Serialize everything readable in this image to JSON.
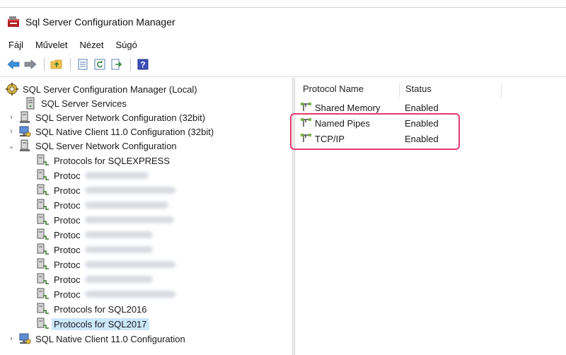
{
  "window": {
    "title": "Sql Server Configuration Manager"
  },
  "menu": [
    "Fájl",
    "Művelet",
    "Nézet",
    "Súgó"
  ],
  "toolbar": {
    "buttons": [
      "back-arrow-icon",
      "forward-arrow-icon",
      "up-folder-icon",
      "properties-icon",
      "refresh-icon",
      "export-icon",
      "help-icon"
    ],
    "help_glyph": "?"
  },
  "tree": {
    "root": "SQL Server Configuration Manager (Local)",
    "services": "SQL Server Services",
    "network32": "SQL Server Network Configuration (32bit)",
    "native32": "SQL Native Client 11.0 Configuration (32bit)",
    "network": "SQL Server Network Configuration",
    "protocols": [
      "Protocols for SQLEXPRESS",
      "Protoc",
      "Protoc",
      "Protoc",
      "Protoc",
      "Protoc",
      "Protoc",
      "Protoc",
      "Protoc",
      "Protoc",
      "Protocols for SQL2016"
    ],
    "selected": "Protocols for SQL2017",
    "native": "SQL Native Client 11.0 Configuration"
  },
  "list": {
    "columns": [
      "Protocol Name",
      "Status"
    ],
    "rows": [
      {
        "name": "Shared Memory",
        "status": "Enabled"
      },
      {
        "name": "Named Pipes",
        "status": "Enabled"
      },
      {
        "name": "TCP/IP",
        "status": "Enabled"
      }
    ]
  },
  "colors": {
    "highlight": "#e63b6f",
    "selection": "#cce8ff"
  }
}
